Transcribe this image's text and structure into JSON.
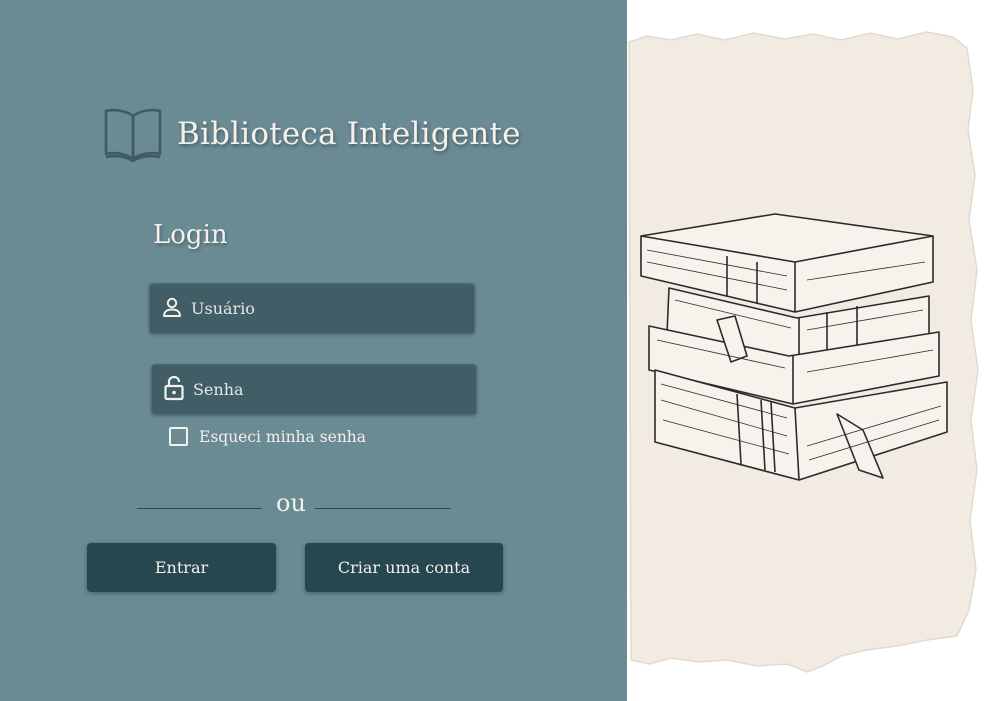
{
  "brand": {
    "title": "Biblioteca Inteligente",
    "logo_icon": "open-book-icon"
  },
  "login": {
    "heading": "Login",
    "username": {
      "placeholder": "Usuário",
      "value": "",
      "icon": "person-icon"
    },
    "password": {
      "placeholder": "Senha",
      "value": "",
      "icon": "lock-icon"
    },
    "forgot_label": "Esqueci minha senha",
    "forgot_checked": false,
    "divider_text": "ou",
    "login_button": "Entrar",
    "create_account_button": "Criar uma conta"
  },
  "illustration": {
    "subject": "stack-of-books-sketch"
  },
  "colors": {
    "panel": "#6a8a94",
    "input": "#415e67",
    "button": "#264650",
    "text": "#f3f1ea",
    "paper": "#f1ebe3",
    "ink": "#2b2b2b"
  }
}
